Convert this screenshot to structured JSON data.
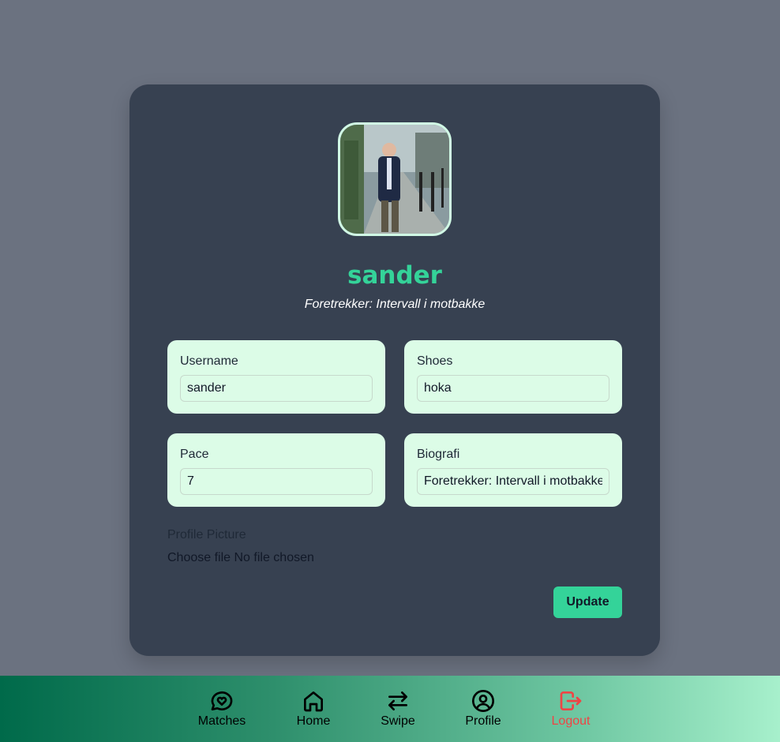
{
  "profile": {
    "name": "sander",
    "subtitle": "Foretrekker: Intervall i motbakke"
  },
  "form": {
    "username_label": "Username",
    "username_value": "sander",
    "shoes_label": "Shoes",
    "shoes_value": "hoka",
    "pace_label": "Pace",
    "pace_value": "7",
    "bio_label": "Biografi",
    "bio_value": "Foretrekker: Intervall i motbakke",
    "picture_label": "Profile Picture",
    "choose_file": "Choose file",
    "no_file": "No file chosen",
    "update_label": "Update"
  },
  "nav": {
    "items": [
      {
        "label": "Matches",
        "icon": "chat-heart-icon"
      },
      {
        "label": "Home",
        "icon": "home-icon"
      },
      {
        "label": "Swipe",
        "icon": "swap-arrows-icon"
      },
      {
        "label": "Profile",
        "icon": "user-circle-icon"
      },
      {
        "label": "Logout",
        "icon": "logout-icon"
      }
    ]
  },
  "colors": {
    "page_bg": "#6b7280",
    "card_bg": "#374151",
    "accent": "#34d399",
    "field_bg": "#dcfce7",
    "logout": "#ef4444"
  }
}
